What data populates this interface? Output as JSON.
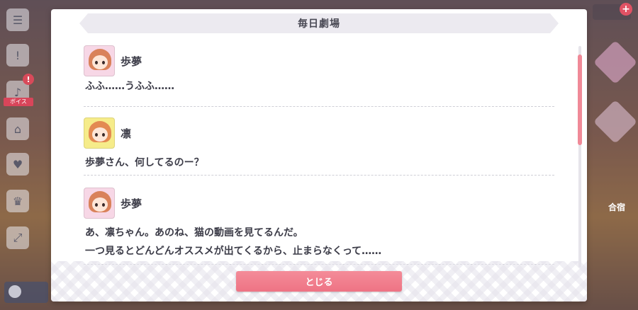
{
  "dialog": {
    "title": "毎日劇場",
    "close_label": "とじる"
  },
  "entries": [
    {
      "speaker": "歩夢",
      "avatar": "ayumu-avatar",
      "lines": [
        "ふふ……うふふ……"
      ]
    },
    {
      "speaker": "凛",
      "avatar": "rin-avatar",
      "lines": [
        "歩夢さん、何してるのー？"
      ]
    },
    {
      "speaker": "歩夢",
      "avatar": "ayumu-avatar",
      "lines": [
        "あ、凛ちゃん。あのね、猫の動画を見てるんだ。",
        "一つ見るとどんどんオススメが出てくるから、止まらなくって……"
      ]
    }
  ],
  "background": {
    "right_label": "合宿",
    "rail_tag": "ボイス"
  },
  "colors": {
    "accent": "#ee7384",
    "scroll_thumb": "#f08a98",
    "ayumu_bg": "#f7d7e6",
    "rin_bg": "#f6ec8a"
  }
}
